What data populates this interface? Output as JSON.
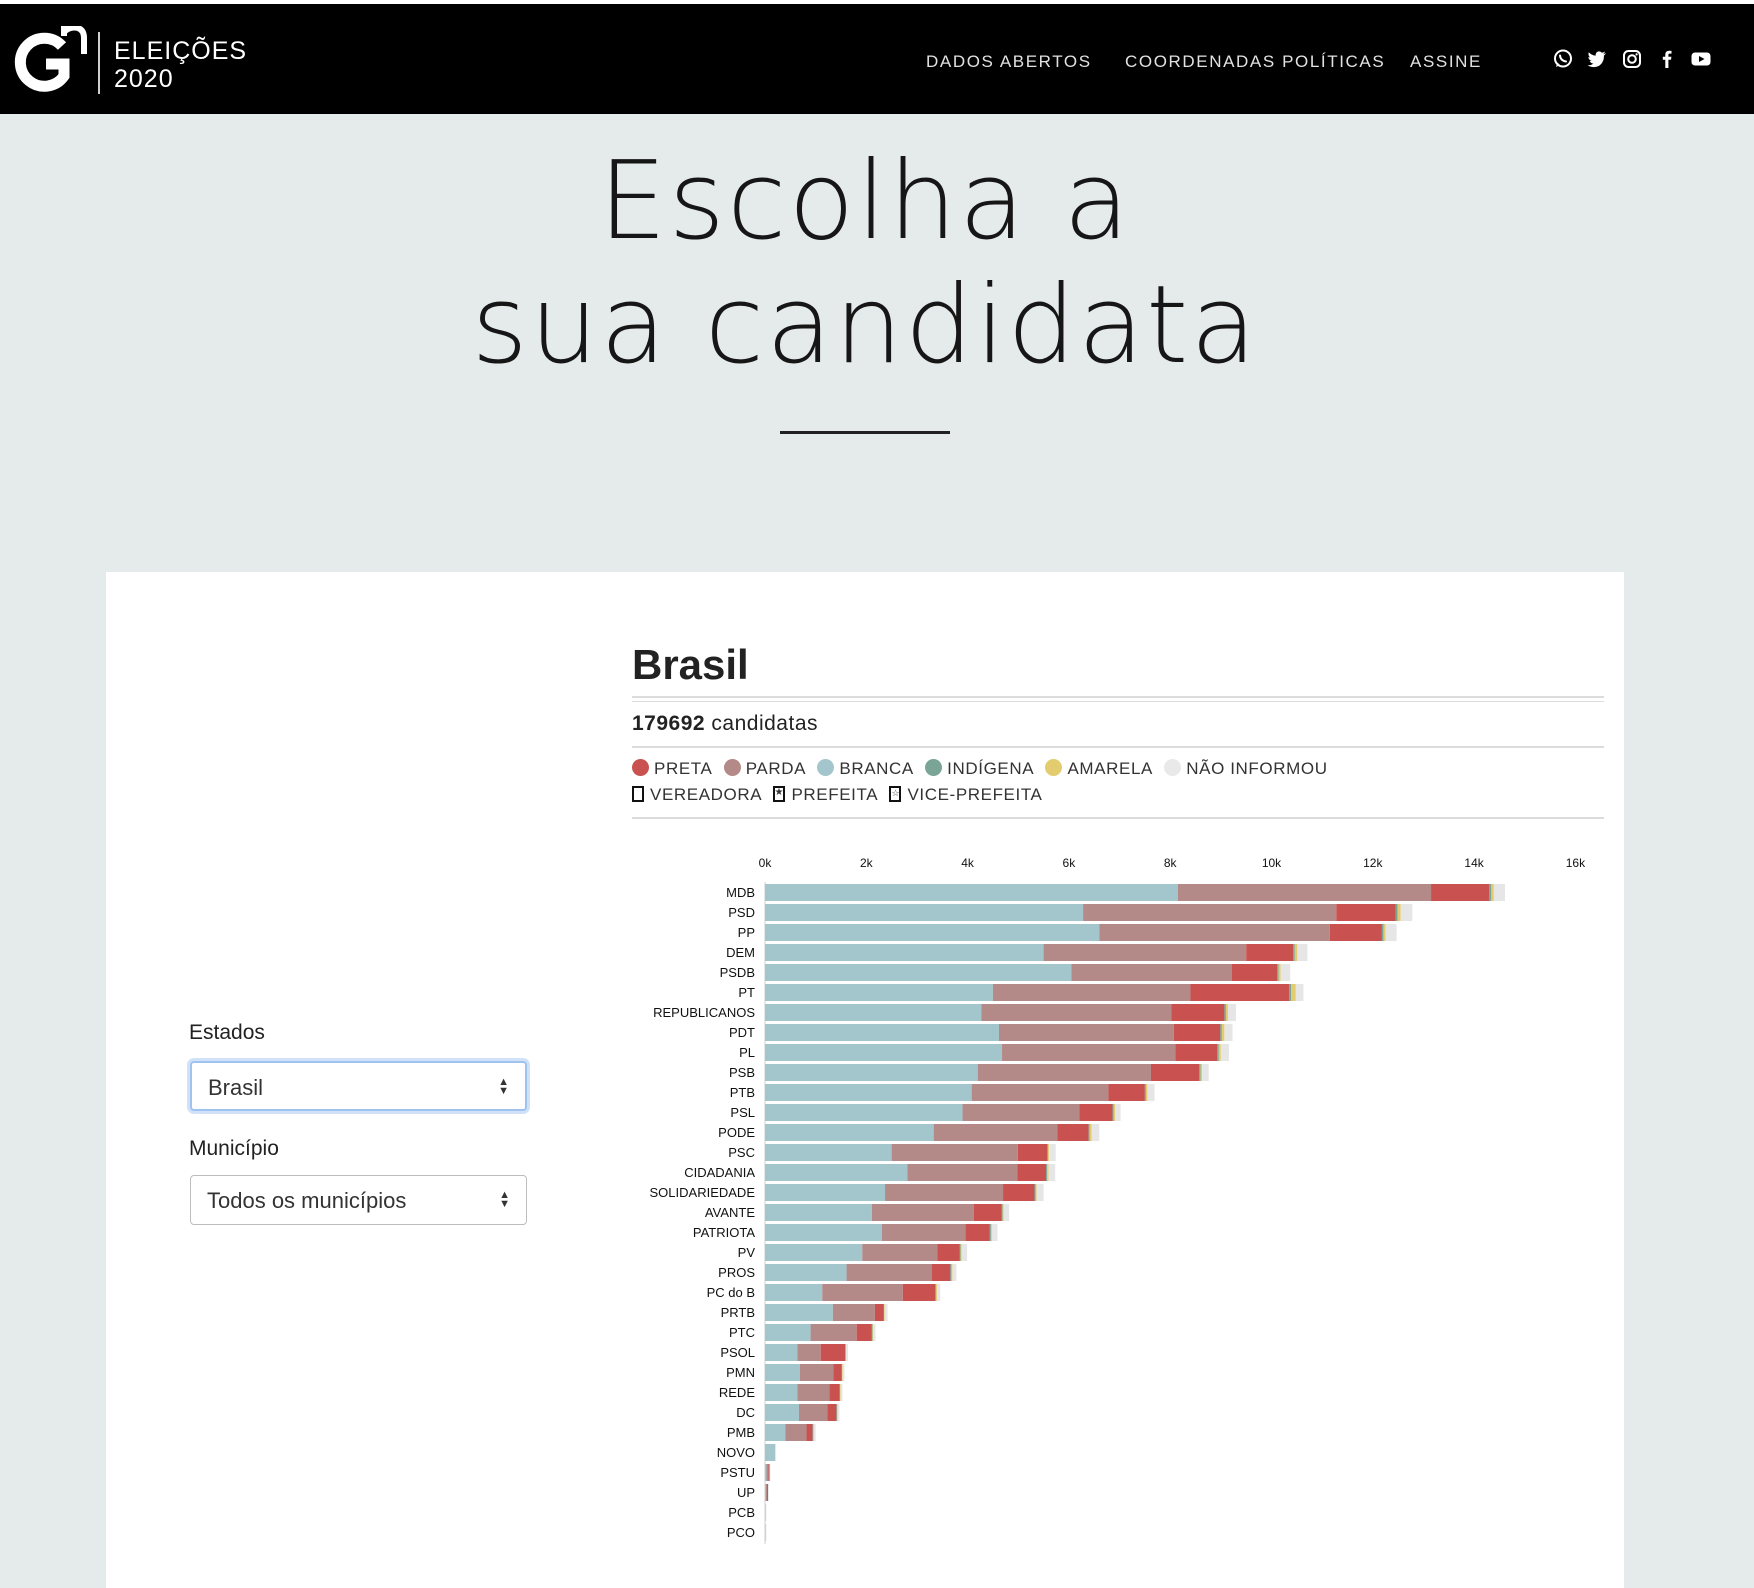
{
  "header": {
    "logo_mark": "Gn",
    "logo_line1": "ELEIÇÕES",
    "logo_line2": "2020",
    "nav": [
      "DADOS ABERTOS",
      "COORDENADAS POLÍTICAS",
      "ASSINE"
    ],
    "social_icons": [
      "whatsapp-icon",
      "twitter-icon",
      "instagram-icon",
      "facebook-icon",
      "youtube-icon"
    ]
  },
  "hero": {
    "title_line1": "Escolha a",
    "title_line2": "sua candidata"
  },
  "filters": {
    "state_label": "Estados",
    "state_value": "Brasil",
    "city_label": "Município",
    "city_value": "Todos os municípios"
  },
  "summary": {
    "region": "Brasil",
    "count": "179692",
    "count_suffix": "candidatas"
  },
  "legend": {
    "colors": [
      {
        "label": "PRETA",
        "color": "#c95251"
      },
      {
        "label": "PARDA",
        "color": "#b48a88"
      },
      {
        "label": "BRANCA",
        "color": "#a3c6cd"
      },
      {
        "label": "INDÍGENA",
        "color": "#7aa596"
      },
      {
        "label": "AMARELA",
        "color": "#e3cc6e"
      },
      {
        "label": "NÃO INFORMOU",
        "color": "#e6e6e6"
      }
    ],
    "roles": [
      "VEREADORA",
      "PREFEITA",
      "VICE-PREFEITA"
    ]
  },
  "chart_data": {
    "type": "bar",
    "orientation": "horizontal",
    "stacked": true,
    "xlim": [
      0,
      16000
    ],
    "x_ticks": [
      "0k",
      "2k",
      "4k",
      "6k",
      "8k",
      "10k",
      "12k",
      "14k",
      "16k"
    ],
    "categories": [
      "MDB",
      "PSD",
      "PP",
      "DEM",
      "PSDB",
      "PT",
      "REPUBLICANOS",
      "PDT",
      "PL",
      "PSB",
      "PTB",
      "PSL",
      "PODE",
      "PSC",
      "CIDADANIA",
      "SOLIDARIEDADE",
      "AVANTE",
      "PATRIOTA",
      "PV",
      "PROS",
      "PC do B",
      "PRTB",
      "PTC",
      "PSOL",
      "PMN",
      "REDE",
      "DC",
      "PMB",
      "NOVO",
      "PSTU",
      "UP",
      "PCB",
      "PCO"
    ],
    "series": [
      {
        "name": "BRANCA",
        "color": "#a3c6cd",
        "values": [
          8150,
          6280,
          6600,
          5500,
          6050,
          4500,
          4270,
          4620,
          4680,
          4200,
          4080,
          3900,
          3330,
          2500,
          2810,
          2370,
          2110,
          2310,
          1920,
          1610,
          1130,
          1340,
          900,
          640,
          690,
          640,
          670,
          400,
          200,
          30,
          20,
          10,
          10
        ]
      },
      {
        "name": "PARDA",
        "color": "#b48a88",
        "values": [
          5000,
          5000,
          4550,
          4000,
          3170,
          3900,
          3750,
          3450,
          3420,
          3420,
          2700,
          2310,
          2440,
          2490,
          2170,
          2330,
          2010,
          1650,
          1480,
          1680,
          1590,
          830,
          910,
          460,
          660,
          630,
          560,
          420,
          0,
          40,
          20,
          0,
          0
        ]
      },
      {
        "name": "PRETA",
        "color": "#c95251",
        "values": [
          1150,
          1170,
          1030,
          930,
          890,
          1950,
          1050,
          920,
          830,
          950,
          720,
          650,
          620,
          580,
          570,
          620,
          550,
          480,
          440,
          370,
          640,
          170,
          300,
          480,
          160,
          200,
          180,
          120,
          0,
          20,
          20,
          0,
          0
        ]
      },
      {
        "name": "INDÍGENA",
        "color": "#7aa596",
        "values": [
          40,
          40,
          30,
          30,
          30,
          40,
          30,
          30,
          30,
          30,
          20,
          20,
          20,
          20,
          20,
          20,
          20,
          20,
          20,
          20,
          20,
          10,
          10,
          10,
          10,
          10,
          10,
          10,
          0,
          0,
          0,
          0,
          0
        ]
      },
      {
        "name": "AMARELA",
        "color": "#e3cc6e",
        "values": [
          50,
          60,
          40,
          50,
          40,
          90,
          40,
          50,
          40,
          30,
          30,
          30,
          40,
          20,
          30,
          20,
          20,
          20,
          20,
          20,
          20,
          10,
          10,
          10,
          10,
          10,
          10,
          10,
          0,
          0,
          0,
          0,
          0
        ]
      },
      {
        "name": "NÃO INFORMOU",
        "color": "#e6e6e6",
        "values": [
          220,
          230,
          220,
          200,
          190,
          150,
          160,
          160,
          160,
          130,
          140,
          110,
          150,
          130,
          130,
          140,
          110,
          110,
          110,
          80,
          60,
          60,
          50,
          40,
          40,
          40,
          40,
          40,
          20,
          10,
          10,
          10,
          10
        ]
      }
    ]
  }
}
